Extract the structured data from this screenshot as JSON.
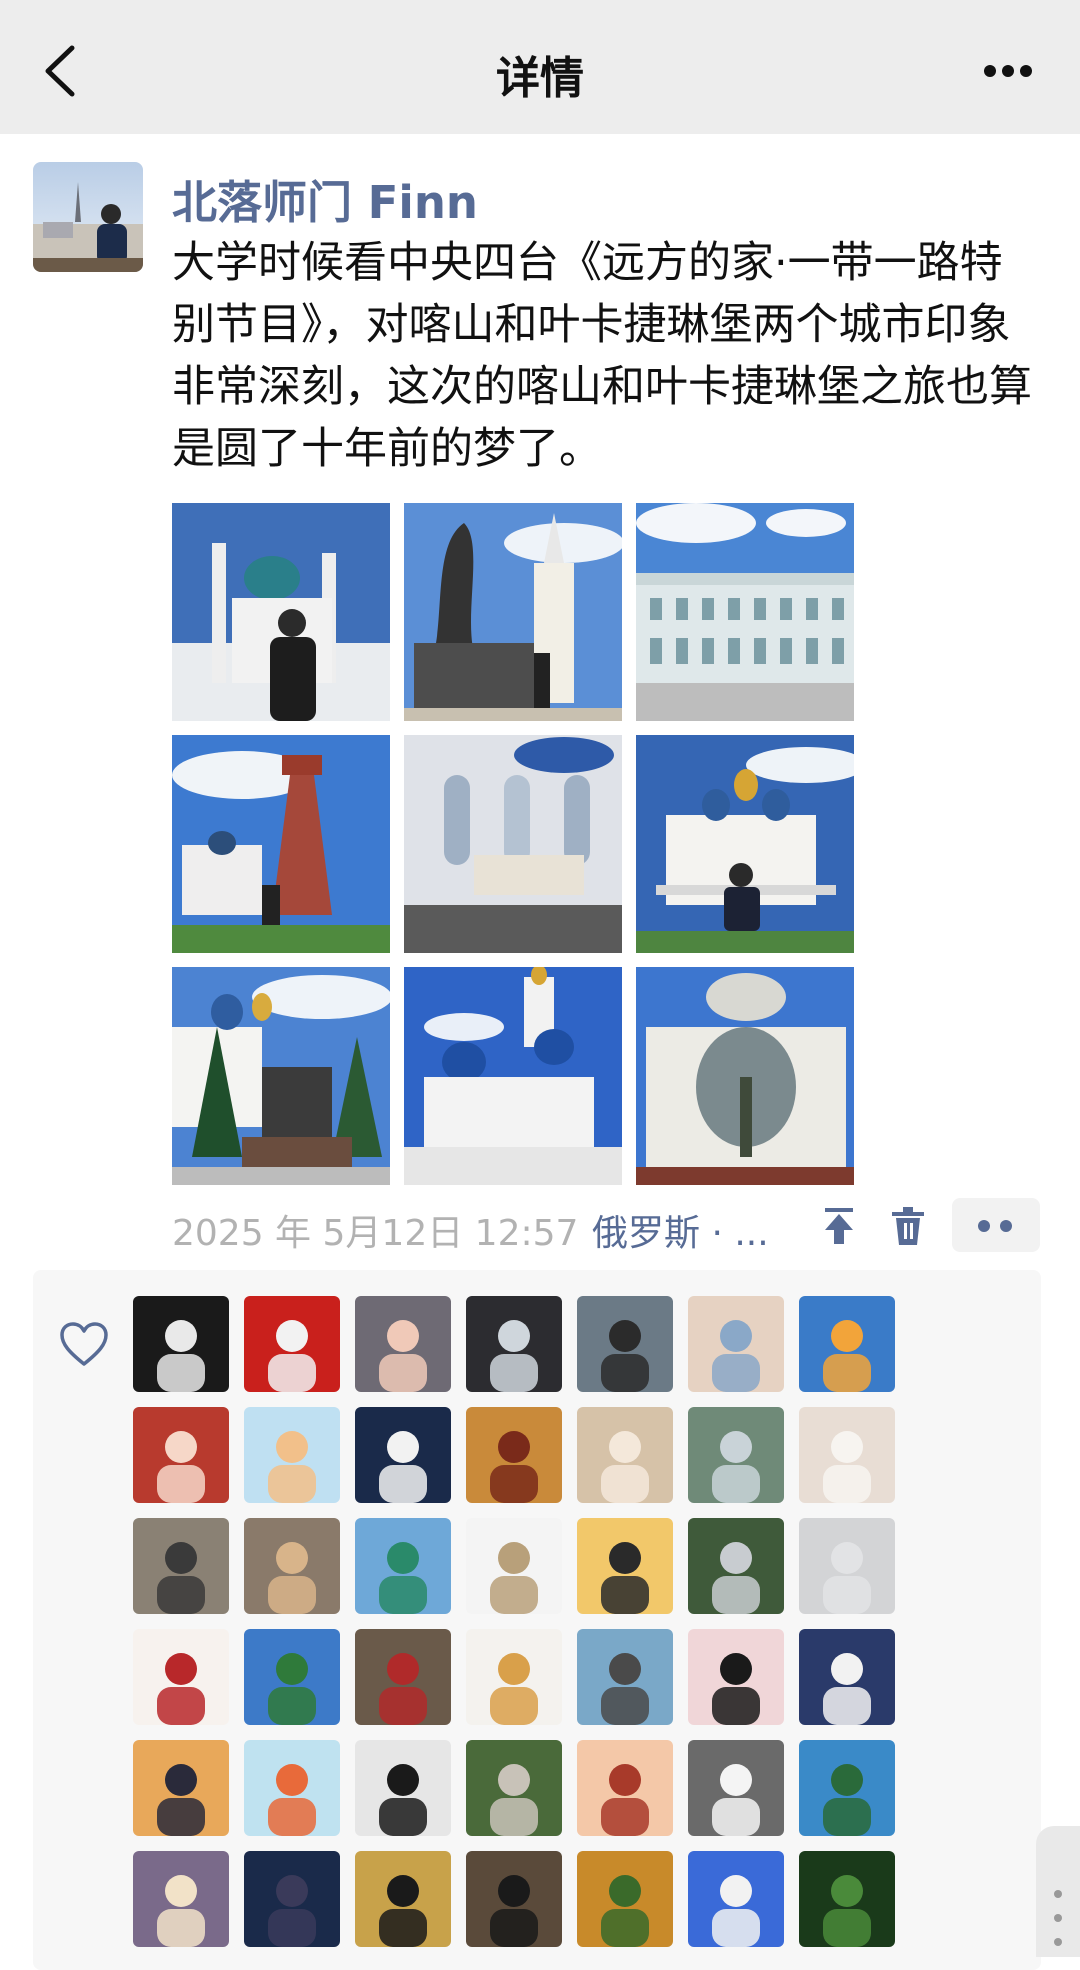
{
  "nav": {
    "title": "详情",
    "back_icon": "chevron-left-icon",
    "more_icon": "more-icon"
  },
  "post": {
    "username": "北落师门 Finn",
    "text": "大学时候看中央四台《远方的家·一带一路特别节目》，对喀山和叶卡捷琳堡两个城市印象非常深刻，这次的喀山和叶卡捷琳堡之旅也算是圆了十年前的梦了。",
    "photos_count": 9,
    "time": "2025 年 5月12日 12:57",
    "location": "俄罗斯 · ..."
  },
  "likes": {
    "icon": "heart-icon",
    "avatar_count": 42
  },
  "colors": {
    "link": "#576b95",
    "timestamp": "#b2b2b2",
    "topbar_bg": "#ededed",
    "panel_bg": "#f7f7f7"
  }
}
